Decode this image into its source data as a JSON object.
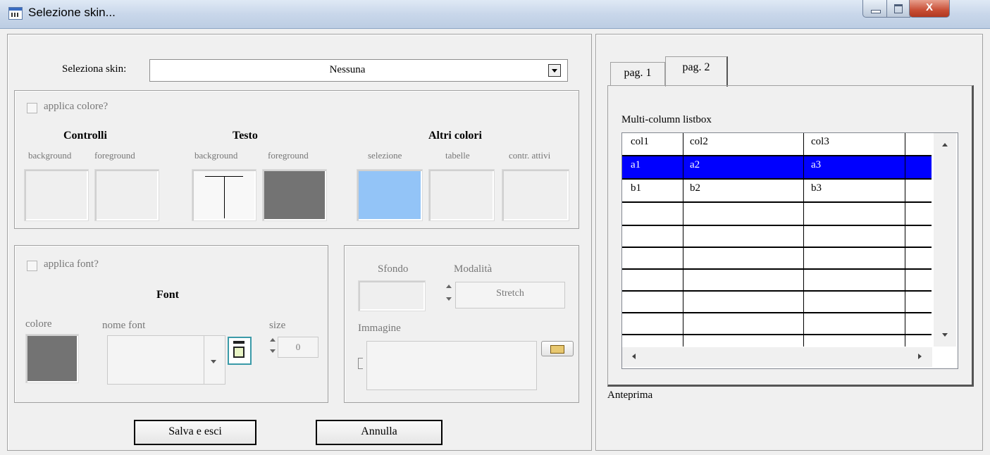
{
  "window": {
    "title": "Selezione skin...",
    "close_glyph": "X"
  },
  "skin": {
    "label": "Seleziona skin:",
    "value": "Nessuna"
  },
  "colors_section": {
    "apply_label": "applica colore?",
    "groups": {
      "controlli": "Controlli",
      "testo": "Testo",
      "altri": "Altri colori"
    },
    "labels": {
      "ctrl_bg": "background",
      "ctrl_fg": "foreground",
      "text_bg": "background",
      "text_fg": "foreground",
      "selezione": "selezione",
      "tabelle": "tabelle",
      "contr_attivi": "contr. attivi"
    },
    "swatch_colors": {
      "text_fg": "#737373",
      "selezione": "#93c4f7"
    }
  },
  "font_section": {
    "apply_label": "applica font?",
    "title": "Font",
    "colore_label": "colore",
    "nome_font_label": "nome font",
    "size_label": "size",
    "size_value": "0",
    "font_color": "#737373"
  },
  "background_section": {
    "sfondo_label": "Sfondo",
    "modalita_label": "Modalità",
    "modalita_value": "Stretch",
    "immagine_label": "Immagine"
  },
  "buttons": {
    "save": "Salva e esci",
    "cancel": "Annulla"
  },
  "preview": {
    "tabs": [
      "pag. 1",
      "pag. 2"
    ],
    "active_tab": 1,
    "listbox_label": "Multi-column listbox",
    "headers": [
      "col1",
      "col2",
      "col3"
    ],
    "rows": [
      [
        "a1",
        "a2",
        "a3"
      ],
      [
        "b1",
        "b2",
        "b3"
      ]
    ],
    "selected_row": 0,
    "selection_color": "#0000ff",
    "caption": "Anteprima"
  }
}
